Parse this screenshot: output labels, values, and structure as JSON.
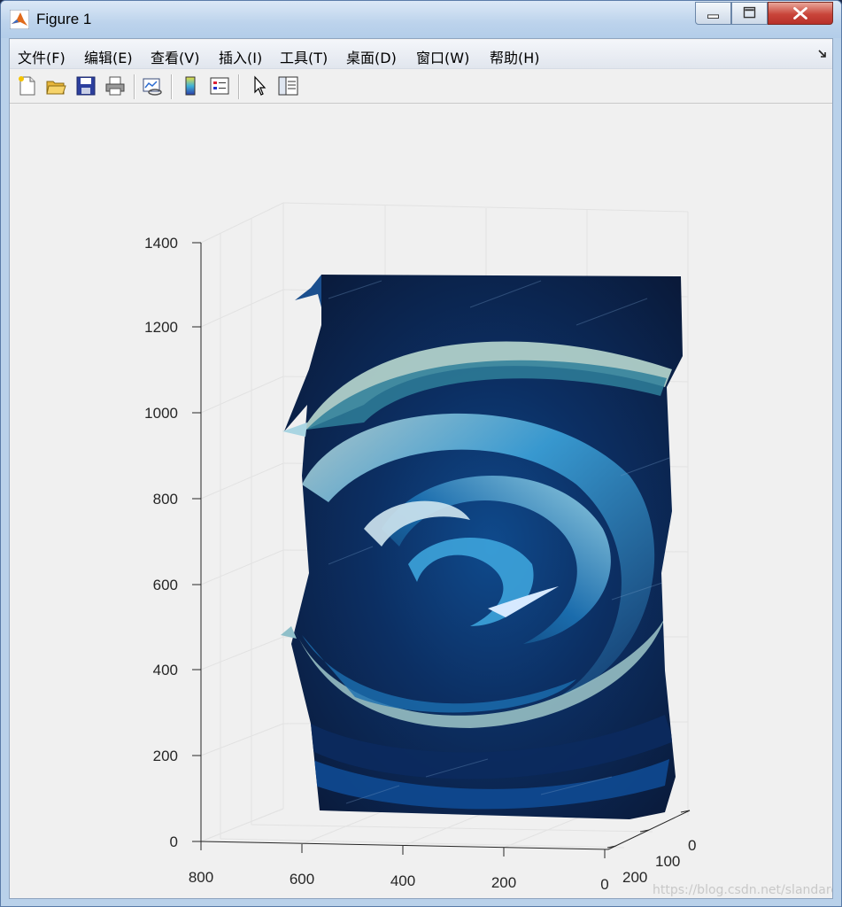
{
  "window": {
    "title": "Figure 1"
  },
  "menubar": {
    "items": [
      {
        "label": "文件(F)"
      },
      {
        "label": "编辑(E)"
      },
      {
        "label": "查看(V)"
      },
      {
        "label": "插入(I)"
      },
      {
        "label": "工具(T)"
      },
      {
        "label": "桌面(D)"
      },
      {
        "label": "窗口(W)"
      },
      {
        "label": "帮助(H)"
      }
    ]
  },
  "toolbar": {
    "icons": [
      "new-figure-icon",
      "open-file-icon",
      "save-icon",
      "print-icon",
      "link-plot-icon",
      "insert-colorbar-icon",
      "insert-legend-icon",
      "edit-plot-pointer-icon",
      "property-inspector-icon"
    ]
  },
  "chart_data": {
    "type": "surface",
    "title": "",
    "xlabel": "",
    "ylabel": "",
    "zlabel": "",
    "x_ticks": [
      800,
      600,
      400,
      200,
      0
    ],
    "y_ticks": [
      0,
      100,
      200
    ],
    "z_ticks": [
      0,
      200,
      400,
      600,
      800,
      1000,
      1200,
      1400
    ],
    "xlim": [
      0,
      800
    ],
    "ylim": [
      0,
      250
    ],
    "zlim": [
      0,
      1400
    ],
    "grid": true,
    "colormap_colors": [
      "#0a1a3a",
      "#123a6e",
      "#1b6fb0",
      "#3fa9e0",
      "#9fd8e8",
      "#c9d9b8"
    ],
    "description_tags": [
      "spiral",
      "swirl"
    ]
  },
  "watermark": {
    "text": "https://blog.csdn.net/slandarer"
  }
}
